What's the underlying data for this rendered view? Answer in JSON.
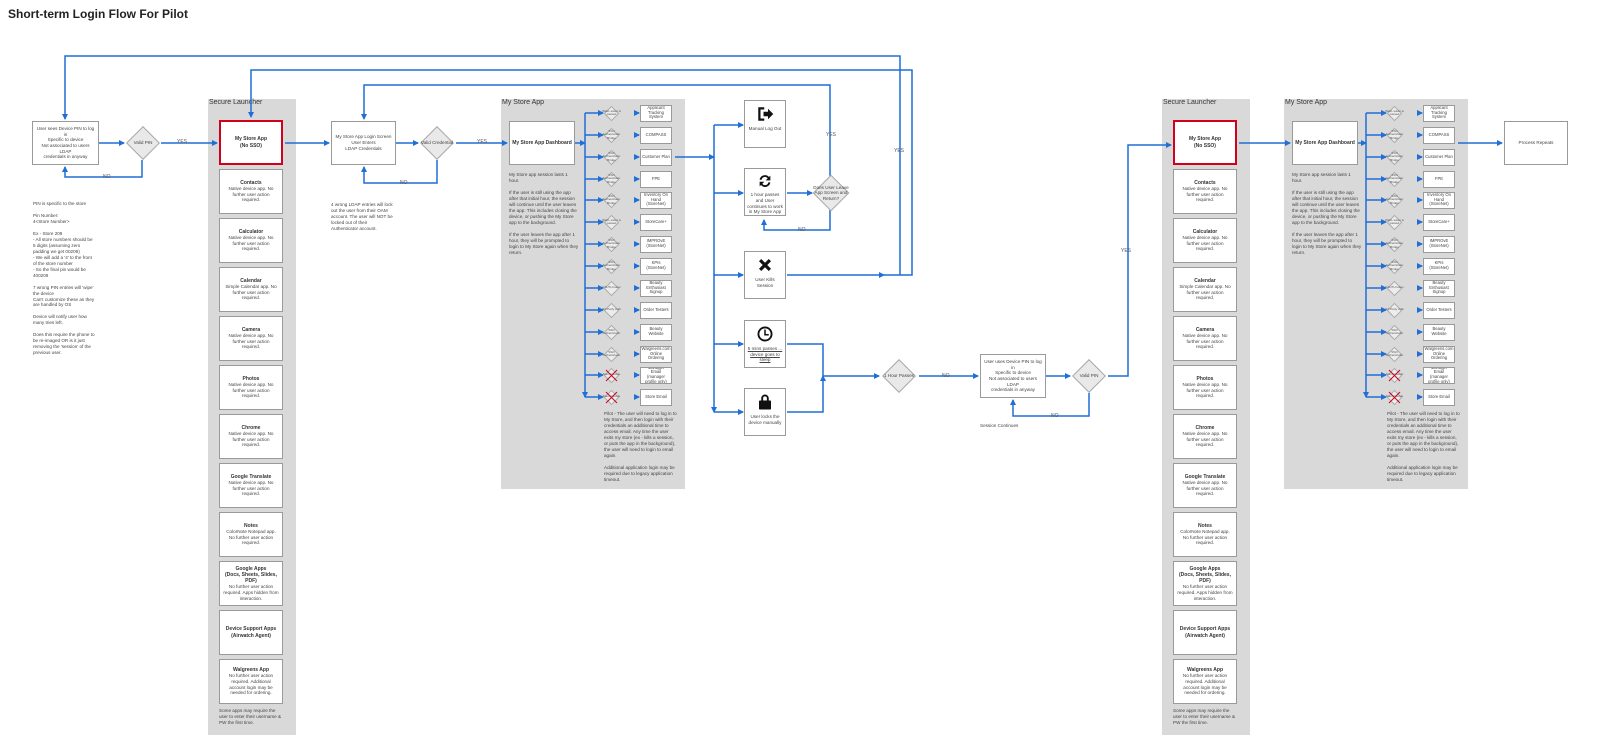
{
  "title": "Short-term Login Flow For Pilot",
  "colors": {
    "arrow": "#1f6fd6",
    "lane": "#d9d9d9",
    "highlight": "#d0021b"
  },
  "start": {
    "box": "User sees Device PIN to log in\nSpecific to device\nNot associated to users LDAP\ncredentials in anyway",
    "diamond": "Valid PIN",
    "yes": "YES",
    "no": "NO",
    "notes": "PIN is specific to the store\n\nPin Number:\n4<Store Number>\n\nEx - Store 209\n- All store numbers should be 5 digits (assuming zero padding we get 00209)\n- We will add a '4' to the front of the store number\n- So the final pin would be 400209\n\n7 wrong PIN entries will 'wipe' the device\nCan't customize these as they are handled by OS\n\nDevice will notify user how many tries left.\n\nDoes this require the phone to be re-imaged OR is it just removing the 'session' of the previous user."
  },
  "launcher": {
    "title": "Secure Launcher",
    "apps": [
      {
        "name": "My Store App\n(No SSO)",
        "desc": ""
      },
      {
        "name": "Contacts",
        "desc": "Native device app. No further user action required."
      },
      {
        "name": "Calculator",
        "desc": "Native device app. No further user action required."
      },
      {
        "name": "Calendar",
        "desc": "Simple Calendar app. No further user action required."
      },
      {
        "name": "Camera",
        "desc": "Native device app. No further user action required."
      },
      {
        "name": "Photos",
        "desc": "Native device app. No further user action required."
      },
      {
        "name": "Chrome",
        "desc": "Native device app. No further user action required."
      },
      {
        "name": "Google Translate",
        "desc": "Native device app. No further user action required."
      },
      {
        "name": "Notes",
        "desc": "ColorNote Notepad app. No further user action required."
      },
      {
        "name": "Google Apps\n(Docs, Sheets, Slides, PDF)",
        "desc": "No further user action required. Apps hidden from interaction."
      },
      {
        "name": "Device Support Apps\n(Airwatch Agent)",
        "desc": ""
      },
      {
        "name": "Walgreens App",
        "desc": "No further user action required. Additional account login may be needed for ordering."
      }
    ],
    "footer": "Some apps may require the user to enter their username & PW the first time."
  },
  "login": {
    "box": "My Store App Login Screen\nUser Enters\nLDAP Credentials",
    "diamond": "Valid Credential",
    "yes": "YES",
    "no": "NO",
    "note": "4 wrong LDAP entries will lock out the user from their OAM account. The user will NOT be locked out of their Authenticator account."
  },
  "mystore": {
    "title": "My Store App",
    "dashboard": "My Store App Dashboard",
    "desc": "My Store app session lasts 1 hour.\n\nIf the user is still using the app after that initial hour, the session will continue until the user leaves the app. This includes closing the device, or pushing the My Store app to the background.\n\nIf the user leaves the app after 1 hour, they will be prompted to login to My Store again when they return.",
    "items": [
      {
        "auth": "WebL token is passed",
        "app": "Applicant Tracking System",
        "red": false
      },
      {
        "auth": "SSO Authenticator Bridge",
        "app": "COMPASS",
        "red": false
      },
      {
        "auth": "SSO Authenticator Bridge",
        "app": "Customer Plan",
        "red": false
      },
      {
        "auth": "SSO Authenticator Bridge",
        "app": "FPE",
        "red": false
      },
      {
        "auth": "SSO Authenticator Bridge",
        "app": "Inventory On Hand (StoreNet)",
        "red": false
      },
      {
        "auth": "WebL token is passed",
        "app": "StoreCare+",
        "red": false
      },
      {
        "auth": "SSO Authenticator Bridge",
        "app": "IMPROvE (StoreNet)",
        "red": false
      },
      {
        "auth": "SSO Authenticator Bridge",
        "app": "KPIs (StoreNet)",
        "red": false
      },
      {
        "auth": "OAUTH token",
        "app": "Beauty Enthusiast Signup",
        "red": false
      },
      {
        "auth": "3rd Party Auth",
        "app": "Order Testers",
        "red": false
      },
      {
        "auth": "SSO Authenticator",
        "app": "Beauty Website",
        "red": false
      },
      {
        "auth": "SSO Authenticator",
        "app": "Walgreens.com Online Ordering",
        "red": false
      },
      {
        "auth": "Sound Guide",
        "app": "Manager Email (manager profile only)",
        "red": true
      },
      {
        "auth": "Sound Guide",
        "app": "Store Email",
        "red": true
      }
    ],
    "pilot_note": "Pilot - The user will need to log in to My Store, and then login with their credentials an additional time to access email. Any time the user exits my store (ex - kills a session, or puts the app in the background), the user will need to login to email again.\n\nAdditional application login may be required due to legacy application timeout."
  },
  "events": {
    "logout": "Manual Log Out",
    "hour": "1 hour passes and User continues to work in My Store App",
    "kill": "User Kills Session",
    "idle": "5 mins passes ... device goes to sleep",
    "lock": "User locks the device manually",
    "leave_diamond": "Does User Leave App Screen and Return?",
    "yes": "YES",
    "no": "NO"
  },
  "middle": {
    "hour_diamond": "1 Hour Passes",
    "no_label": "NO",
    "yes_label": "YES",
    "box": "User uses Device PIN to log in\nSpecific to device\nNot associated to users LDAP\ncredentials in anyway",
    "diamond": "Valid PIN",
    "yes": "YES",
    "no": "NO",
    "session": "Session Continues"
  },
  "repeat": "Process Repeats"
}
